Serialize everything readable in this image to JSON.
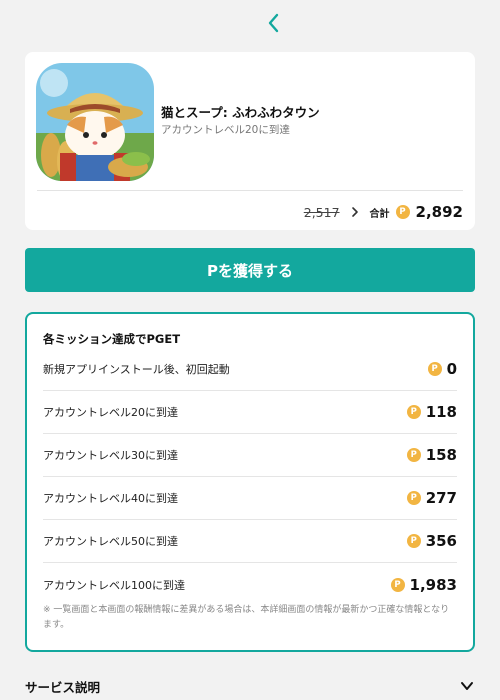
{
  "nav": {
    "back_icon": "chevron-left-icon",
    "accent": "#13a89e"
  },
  "app": {
    "name": "猫とスープ: ふわふわタウン",
    "subtitle": "アカウントレベル20に到達",
    "icon": "cat-farmer-app-icon"
  },
  "price": {
    "old": "2,517",
    "total_label": "合計",
    "coin_symbol": "P",
    "total": "2,892"
  },
  "get_button": {
    "label": "Pを獲得する",
    "color": "#13a89e"
  },
  "missions": {
    "title": "各ミッション達成でPGET",
    "coin_symbol": "P",
    "items": [
      {
        "label": "新規アプリインストール後、初回起動",
        "points": "0"
      },
      {
        "label": "アカウントレベル20に到達",
        "points": "118"
      },
      {
        "label": "アカウントレベル30に到達",
        "points": "158"
      },
      {
        "label": "アカウントレベル40に到達",
        "points": "277"
      },
      {
        "label": "アカウントレベル50に到達",
        "points": "356"
      },
      {
        "label": "アカウントレベル100に到達",
        "points": "1,983"
      }
    ],
    "note": "※ 一覧画面と本画面の報酬情報に差異がある場合は、本詳細画面の情報が最新かつ正確な情報となります。"
  },
  "service": {
    "label": "サービス説明",
    "icon": "chevron-down-icon"
  }
}
